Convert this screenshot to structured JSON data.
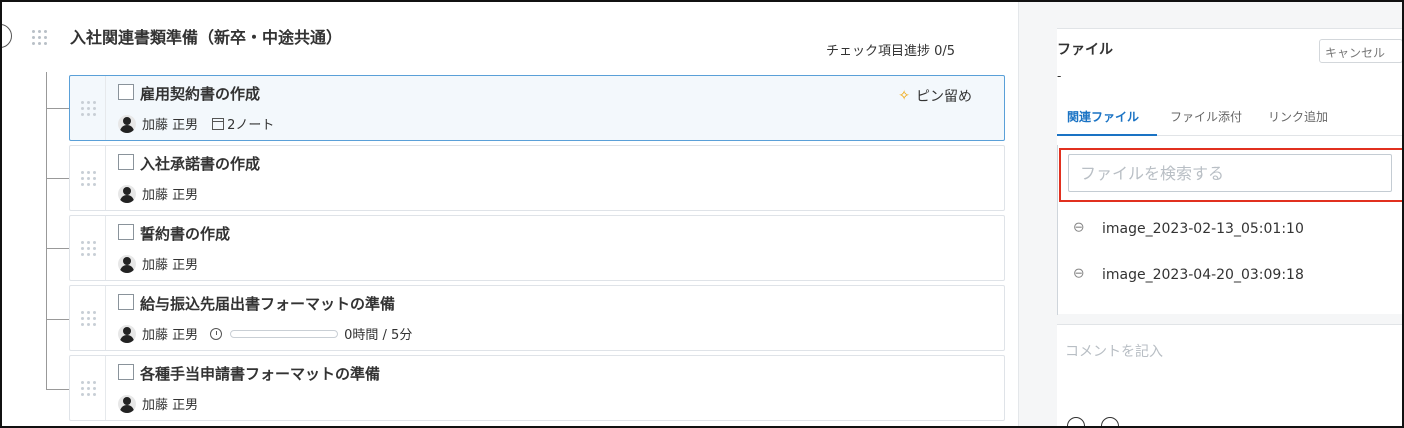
{
  "group": {
    "title": "入社関連書類準備（新卒・中途共通）",
    "progress": "チェック項目進捗 0/5"
  },
  "tasks": [
    {
      "title": "雇用契約書の作成",
      "assignee": "加藤 正男",
      "notes": "2ノート",
      "pin_label": "ピン留め"
    },
    {
      "title": "入社承諾書の作成",
      "assignee": "加藤 正男"
    },
    {
      "title": "誓約書の作成",
      "assignee": "加藤 正男"
    },
    {
      "title": "給与振込先届出書フォーマットの準備",
      "assignee": "加藤 正男",
      "time": "0時間 / 5分",
      "time_progress": 0
    },
    {
      "title": "各種手当申請書フォーマットの準備",
      "assignee": "加藤 正男"
    }
  ],
  "file_panel": {
    "title": "ファイル",
    "cancel": "キャンセル",
    "dash": "-",
    "tabs": [
      "関連ファイル",
      "ファイル添付",
      "リンク追加"
    ],
    "active_tab": "関連ファイル",
    "search_placeholder": "ファイルを検索する",
    "files": [
      "image_2023-02-13_05:01:10",
      "image_2023-04-20_03:09:18"
    ]
  },
  "comment": {
    "placeholder": "コメントを記入"
  },
  "icons": {
    "grip": "drag-handle-icon",
    "pin": "pin-icon",
    "note": "note-icon",
    "timer": "timer-icon",
    "clip": "paperclip-icon",
    "avatar": "user-avatar"
  },
  "colors": {
    "accent": "#1a73c4",
    "highlight": "#e1301f",
    "pin": "#f0a300",
    "active_task_bg": "#f3f8fc"
  }
}
